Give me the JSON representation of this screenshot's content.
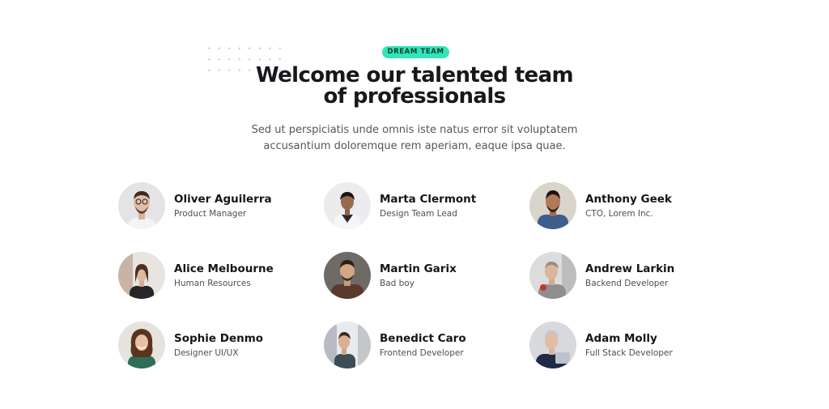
{
  "colors": {
    "accent": "#2ee6b8"
  },
  "header": {
    "badge": "DREAM TEAM",
    "title_line1": "Welcome our talented team",
    "title_line2": "of professionals",
    "subtitle_line1": "Sed ut perspiciatis unde omnis iste natus error sit voluptatem",
    "subtitle_line2": "accusantium doloremque rem aperiam, eaque ipsa quae."
  },
  "members": [
    {
      "name": "Oliver Aguilerra",
      "role": "Product Manager"
    },
    {
      "name": "Marta Clermont",
      "role": "Design Team Lead"
    },
    {
      "name": "Anthony Geek",
      "role": "CTO, Lorem Inc."
    },
    {
      "name": "Alice Melbourne",
      "role": "Human Resources"
    },
    {
      "name": "Martin Garix",
      "role": "Bad boy"
    },
    {
      "name": "Andrew Larkin",
      "role": "Backend Developer"
    },
    {
      "name": "Sophie Denmo",
      "role": "Designer UI/UX"
    },
    {
      "name": "Benedict Caro",
      "role": "Frontend Developer"
    },
    {
      "name": "Adam Molly",
      "role": "Full Stack Developer"
    }
  ]
}
